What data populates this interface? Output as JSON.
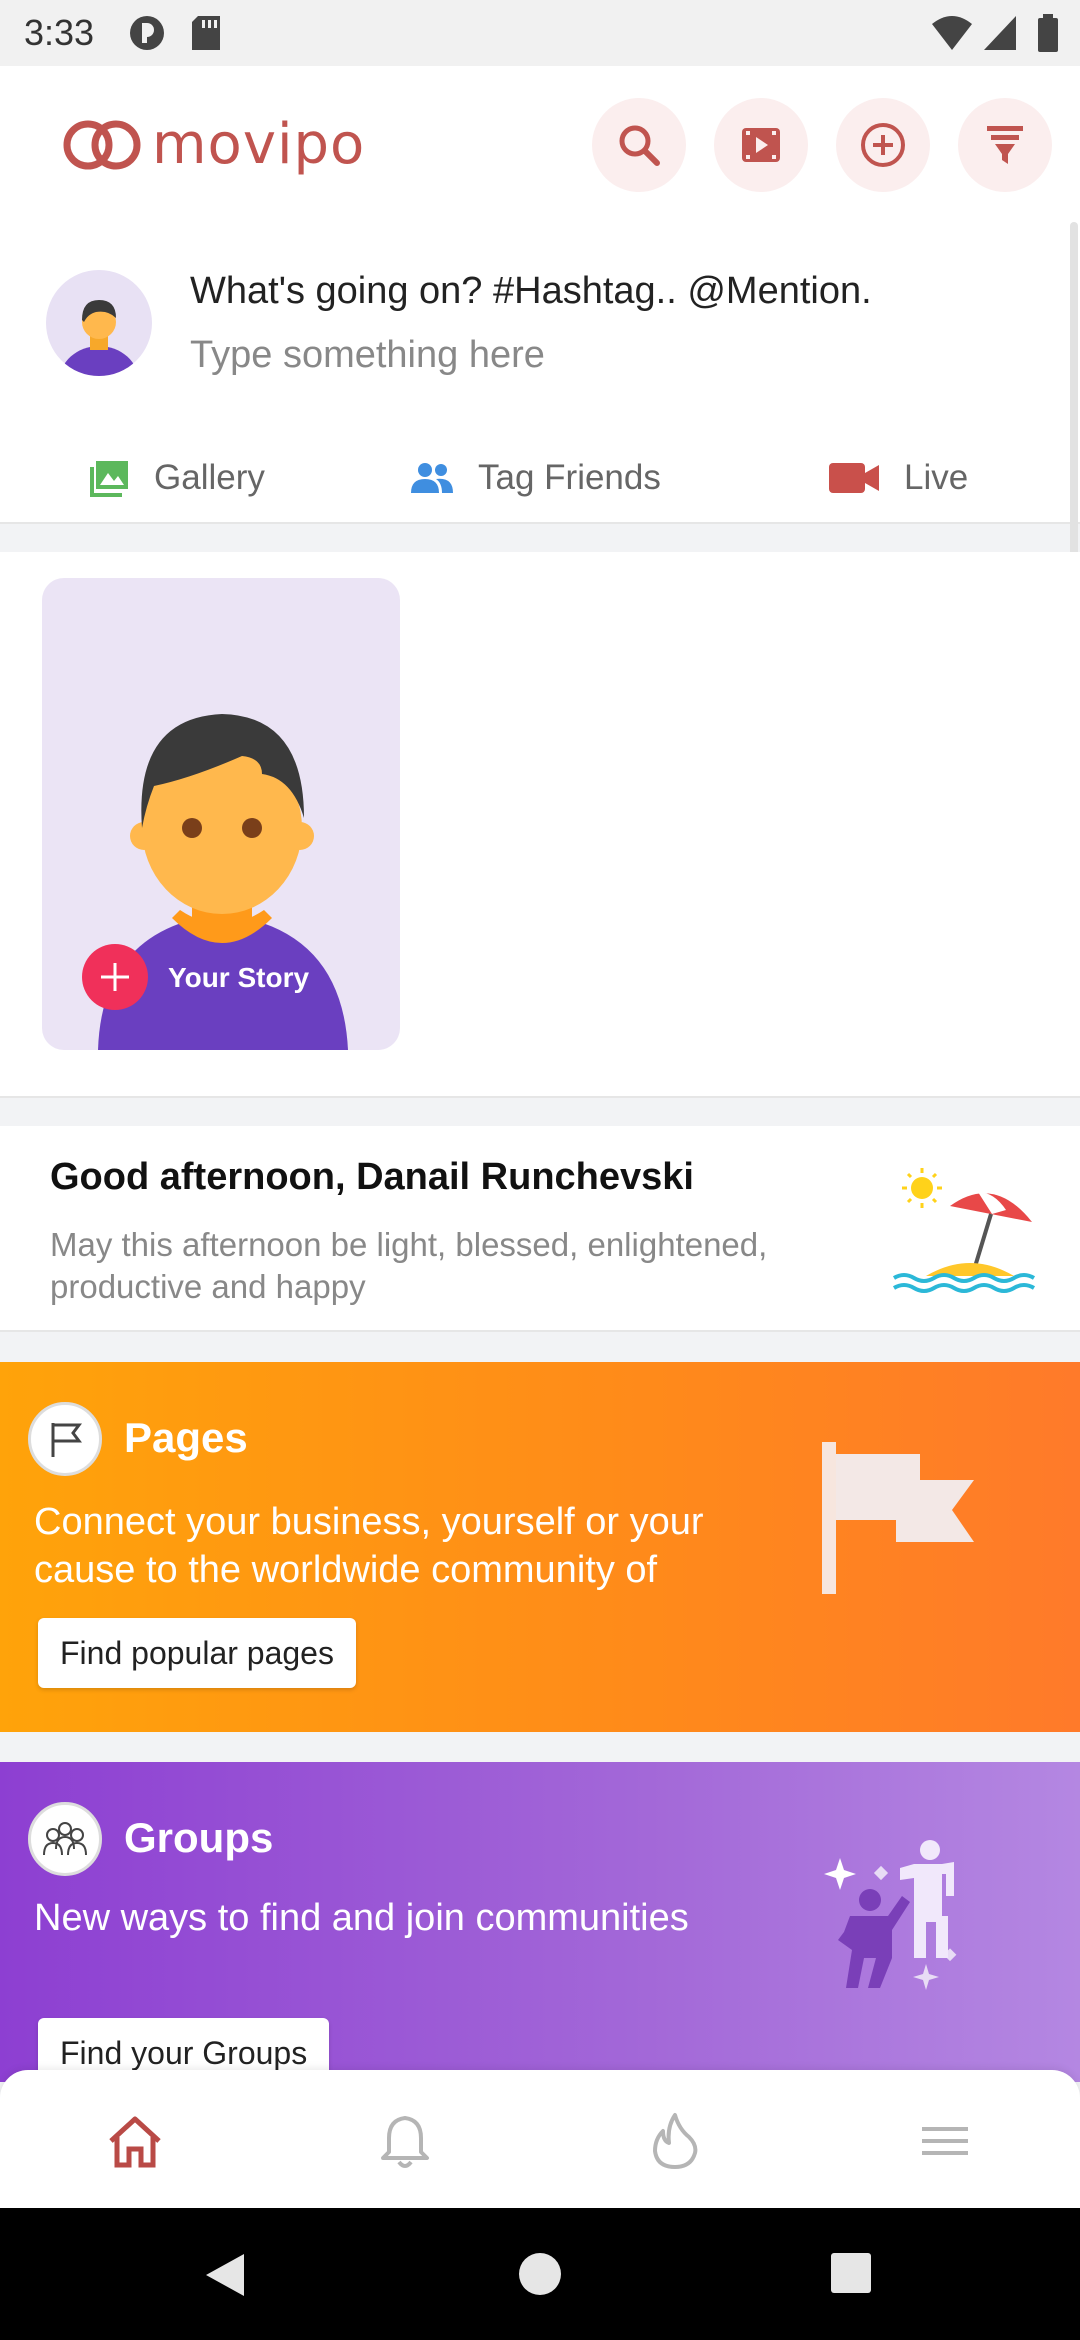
{
  "status_bar": {
    "time": "3:33"
  },
  "header": {
    "logo_text": "movipo",
    "brand_color": "#c0544f",
    "icons": [
      "search-icon",
      "video-icon",
      "add-circle-icon",
      "filter-icon"
    ]
  },
  "composer": {
    "prompt": "What's going on? #Hashtag.. @Mention.",
    "placeholder": "Type something here",
    "tabs": [
      {
        "label": "Gallery",
        "icon": "gallery-icon",
        "color": "#5cb85c"
      },
      {
        "label": "Tag Friends",
        "icon": "people-icon",
        "color": "#3f8ee0"
      },
      {
        "label": "Live",
        "icon": "videocam-icon",
        "color": "#c9504b"
      }
    ]
  },
  "stories": {
    "your_story_label": "Your Story"
  },
  "greeting": {
    "title": "Good afternoon, Danail Runchevski",
    "subtitle": "May this afternoon be light, blessed, enlightened, productive and happy"
  },
  "pages_promo": {
    "title": "Pages",
    "text": "Connect your business, yourself or your cause to the worldwide community of",
    "button": "Find popular pages"
  },
  "groups_promo": {
    "title": "Groups",
    "text": "New ways to find and join communities",
    "button": "Find your Groups"
  },
  "bottom_nav": {
    "items": [
      "home-icon",
      "bell-icon",
      "flame-icon",
      "menu-icon"
    ],
    "active": "home-icon"
  }
}
